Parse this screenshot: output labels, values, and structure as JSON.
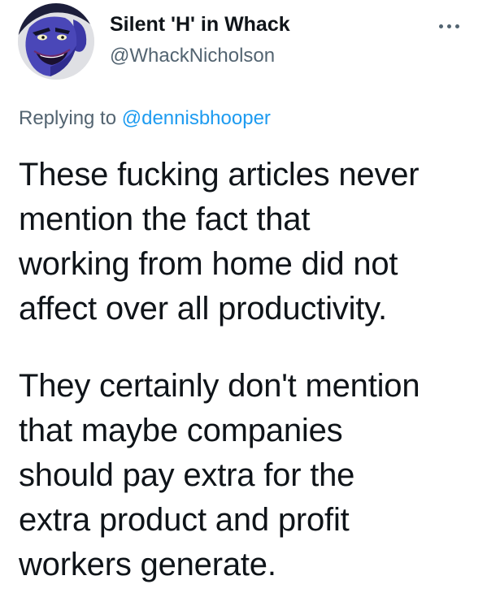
{
  "tweet": {
    "author": {
      "display_name": "Silent 'H' in Whack",
      "handle": "@WhackNicholson",
      "avatar_icon": "cartoon-villain-avatar"
    },
    "more_icon": "more-horizontal-icon",
    "reply": {
      "prefix": "Replying to",
      "mention": "@dennisbhooper"
    },
    "paragraphs": [
      {
        "lines": [
          "These fucking articles never",
          "mention the fact that",
          "working from home did not",
          "affect over all productivity."
        ]
      },
      {
        "lines": [
          "They certainly don't mention",
          "that maybe companies",
          "should pay extra for the",
          "extra product and profit",
          "workers generate."
        ]
      }
    ],
    "colors": {
      "text": "#0f1419",
      "secondary": "#536471",
      "link": "#1d9bf0",
      "avatar_skin": "#4a47b8"
    }
  }
}
